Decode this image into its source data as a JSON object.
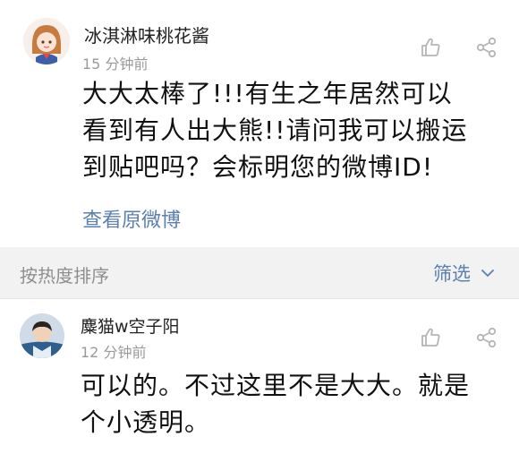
{
  "comment1": {
    "username": "冰淇淋味桃花酱",
    "time": "15 分钟前",
    "text_line1": "大大太棒了!!!有生之年居然可以",
    "text_line2": "看到有人出大熊!!请问我可以搬运",
    "text_line3": "到贴吧吗？会标明您的微博ID!",
    "link": "查看原微博",
    "like_icon": "thumbs-up-icon",
    "share_icon": "share-icon"
  },
  "sort_bar": {
    "label": "按热度排序",
    "filter_label": "筛选",
    "filter_icon": "chevron-down-icon"
  },
  "comment2": {
    "username": "麋猫w空子阳",
    "time": "12 分钟前",
    "text_line1": "可以的。不过这里不是大大。就是",
    "text_line2": "个小透明。",
    "like_icon": "thumbs-up-icon",
    "share_icon": "share-icon"
  },
  "colors": {
    "link": "#5a7fb0",
    "muted": "#9a9a9a",
    "sort_bar_bg": "#f2f2f2"
  }
}
